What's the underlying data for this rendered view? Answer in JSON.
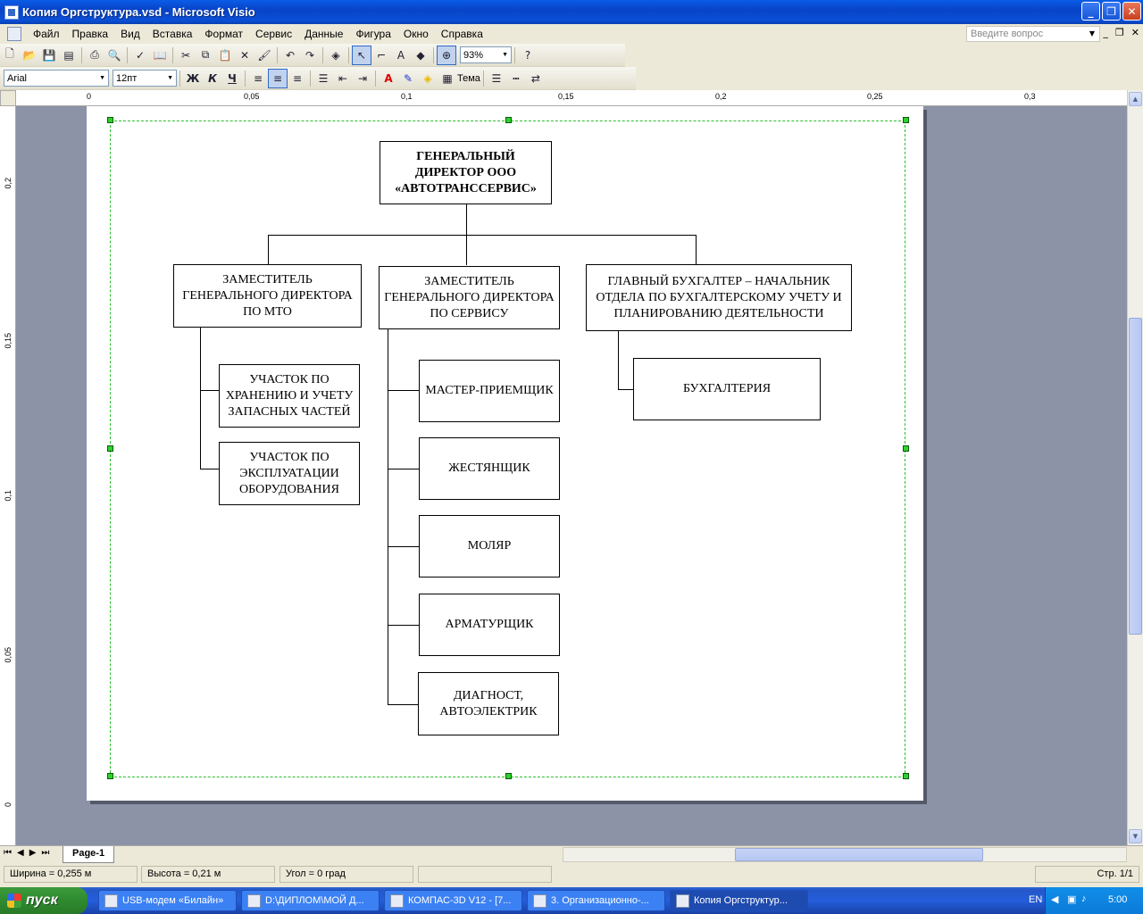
{
  "window": {
    "title": "Копия Оргструктура.vsd - Microsoft Visio"
  },
  "menu": {
    "items": [
      "Файл",
      "Правка",
      "Вид",
      "Вставка",
      "Формат",
      "Сервис",
      "Данные",
      "Фигура",
      "Окно",
      "Справка"
    ],
    "ask_placeholder": "Введите вопрос"
  },
  "toolbar": {
    "zoom": "93%",
    "font": "Arial",
    "size": "12пт",
    "bold": "Ж",
    "italic": "К",
    "underline": "Ч",
    "theme": "Тема"
  },
  "ruler": {
    "h_labels": [
      "0",
      "0,05",
      "0,1",
      "0,15",
      "0,2",
      "0,25",
      "0,3"
    ],
    "v_labels": [
      "0,2",
      "0,15",
      "0,1",
      "0,05",
      "0"
    ]
  },
  "diagram": {
    "director": "ГЕНЕРАЛЬНЫЙ ДИРЕКТОР ООО «АВТОТРАНССЕРВИС»",
    "deputy_mto": "ЗАМЕСТИТЕЛЬ ГЕНЕРАЛЬНОГО ДИРЕКТОРА ПО МТО",
    "deputy_service": "ЗАМЕСТИТЕЛЬ ГЕНЕРАЛЬНОГО ДИРЕКТОРА ПО СЕРВИСУ",
    "chief_accountant": "ГЛАВНЫЙ БУХГАЛТЕР – НАЧАЛЬНИК ОТДЕЛА ПО БУХГАЛТЕРСКОМУ УЧЕТУ И ПЛАНИРОВАНИЮ ДЕЯТЕЛЬНОСТИ",
    "mto_units": [
      "УЧАСТОК ПО ХРАНЕНИЮ И УЧЕТУ ЗАПАСНЫХ ЧАСТЕЙ",
      "УЧАСТОК ПО ЭКСПЛУАТАЦИИ ОБОРУДОВАНИЯ"
    ],
    "service_units": [
      "МАСТЕР-ПРИЕМЩИК",
      "ЖЕСТЯНЩИК",
      "МОЛЯР",
      "АРМАТУРЩИК",
      "ДИАГНОСТ, АВТОЭЛЕКТРИК"
    ],
    "accounting": "БУХГАЛТЕРИЯ"
  },
  "tabs": {
    "page": "Page-1"
  },
  "status": {
    "width": "Ширина = 0,255 м",
    "height": "Высота = 0,21 м",
    "angle": "Угол = 0 град",
    "page": "Стр. 1/1"
  },
  "taskbar": {
    "start": "пуск",
    "tasks": [
      "USB-модем «Билайн»",
      "D:\\ДИПЛОМ\\МОЙ Д...",
      "КОМПАС-3D V12 - [7...",
      "3. Организационно-...",
      "Копия Оргструктур..."
    ],
    "lang": "EN",
    "clock": "5:00"
  }
}
